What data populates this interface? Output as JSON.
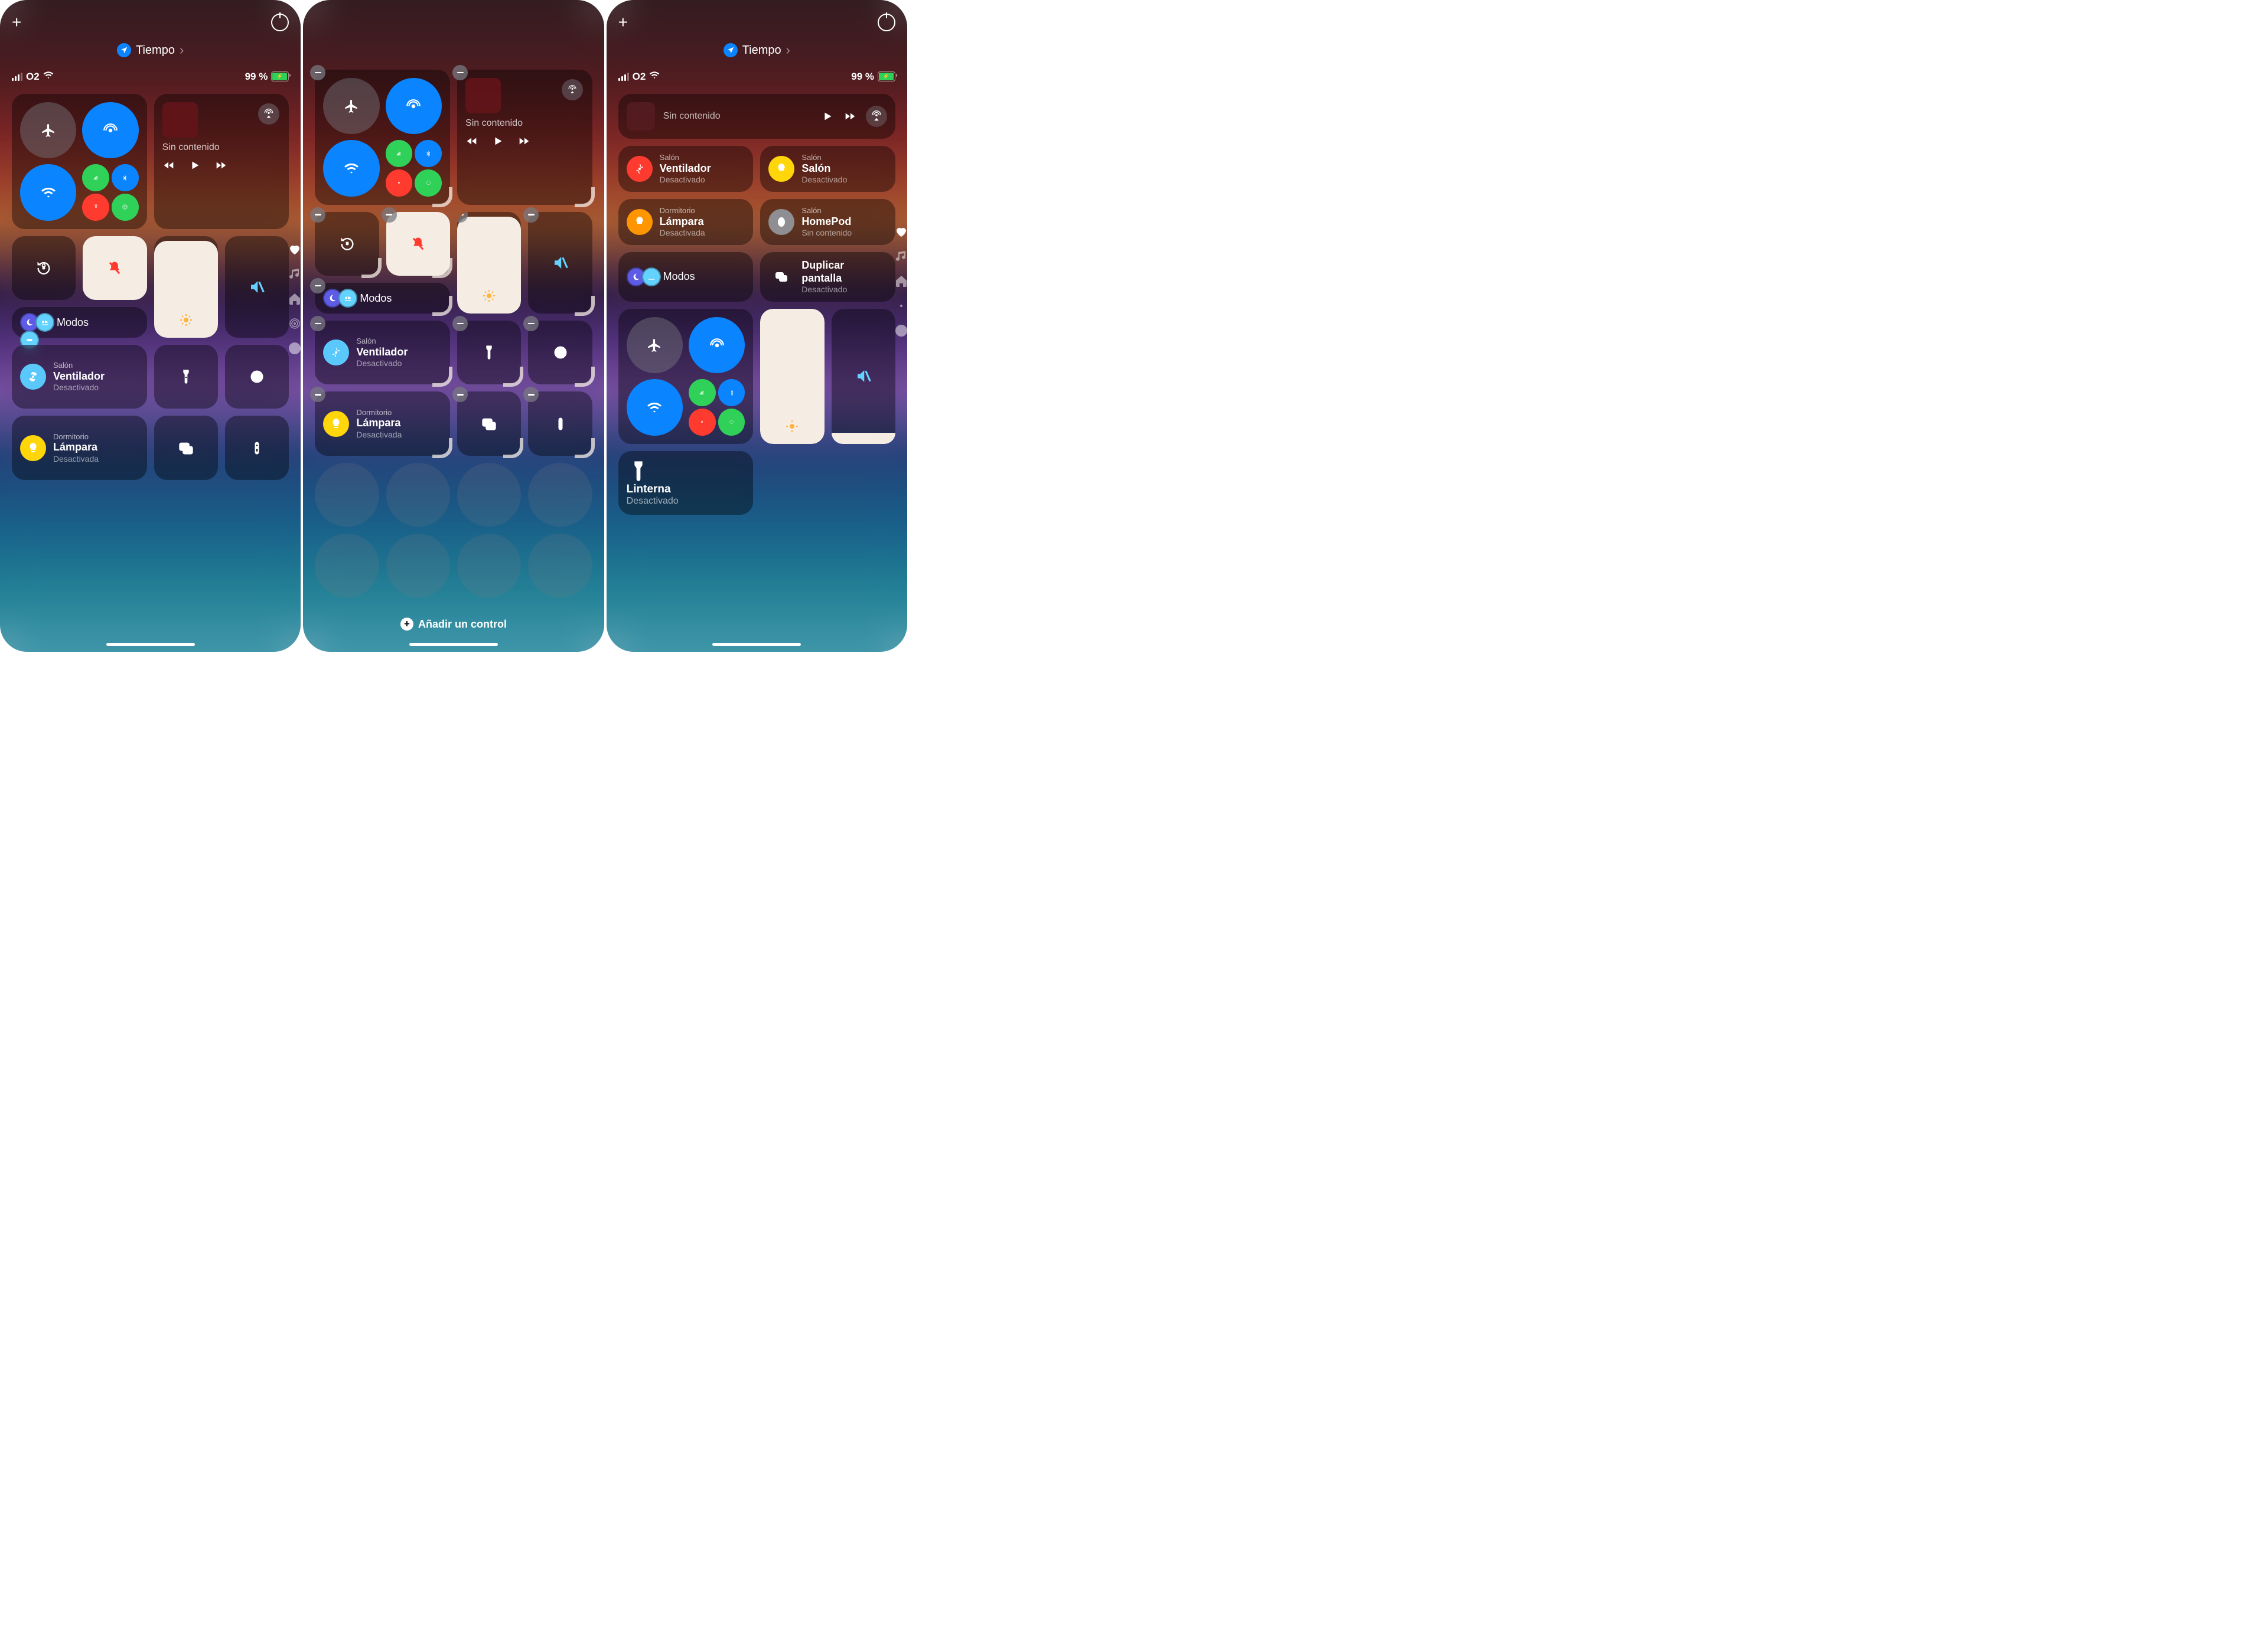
{
  "header": {
    "location_label": "Tiempo",
    "carrier": "O2",
    "battery_percent": "99 %"
  },
  "media": {
    "no_content": "Sin contenido"
  },
  "modes": {
    "label": "Modos"
  },
  "home": {
    "fan": {
      "room": "Salón",
      "name": "Ventilador",
      "state": "Desactivado"
    },
    "lamp_bedroom": {
      "room": "Dormitorio",
      "name": "Lámpara",
      "state": "Desactivada"
    },
    "lamp_salon": {
      "room": "Salón",
      "name": "Salón",
      "state": "Desactivado"
    },
    "homepod": {
      "room": "Salón",
      "name": "HomePod",
      "state": "Sin contenido"
    },
    "mirror": {
      "name": "Duplicar pantalla",
      "state": "Desactivado"
    },
    "torch": {
      "name": "Linterna",
      "state": "Desactivado"
    }
  },
  "edit": {
    "add_control": "Añadir un control"
  }
}
